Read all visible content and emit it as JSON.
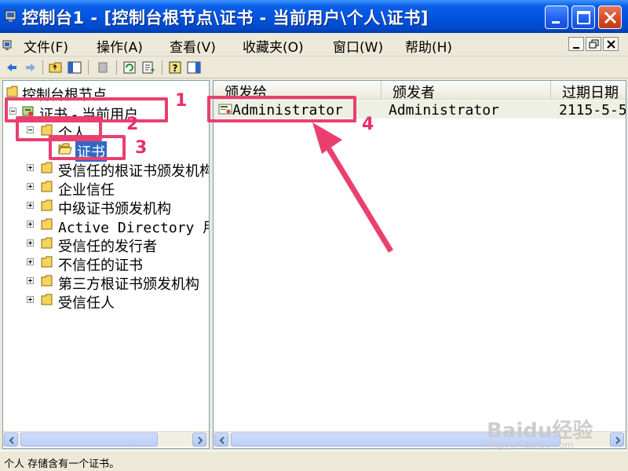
{
  "window": {
    "title": "控制台1 - [控制台根节点\\证书 - 当前用户\\个人\\证书]"
  },
  "menu": [
    {
      "label": "文件(F)"
    },
    {
      "label": "操作(A)"
    },
    {
      "label": "查看(V)"
    },
    {
      "label": "收藏夹(O)"
    },
    {
      "label": "窗口(W)"
    },
    {
      "label": "帮助(H)"
    }
  ],
  "tree": {
    "root": "控制台根节点",
    "certs_current_user": "证书 - 当前用户",
    "personal": "个人",
    "certificates": "证书",
    "trusted_root": "受信任的根证书颁发机构",
    "enterprise_trust": "企业信任",
    "intermediate_ca": "中级证书颁发机构",
    "active_directory": "Active Directory 用户对象",
    "trusted_publishers": "受信任的发行者",
    "untrusted": "不信任的证书",
    "third_party_root": "第三方根证书颁发机构",
    "trusted_people": "受信任人"
  },
  "list": {
    "columns": [
      "颁发给",
      "颁发者",
      "过期日期"
    ],
    "rows": [
      {
        "issued_to": "Administrator",
        "issued_by": "Administrator",
        "expires": "2115-5-5"
      }
    ]
  },
  "status": {
    "text": "个人 存储含有一个证书。"
  },
  "annotations": {
    "n1": "1",
    "n2": "2",
    "n3": "3",
    "n4": "4"
  },
  "watermark": {
    "logo": "Baidu经验",
    "url": "jingyan.baidu.com"
  },
  "colors": {
    "selection": "#316ac5",
    "callout": "#ea3f6f",
    "titlebar": "#0054e3"
  }
}
